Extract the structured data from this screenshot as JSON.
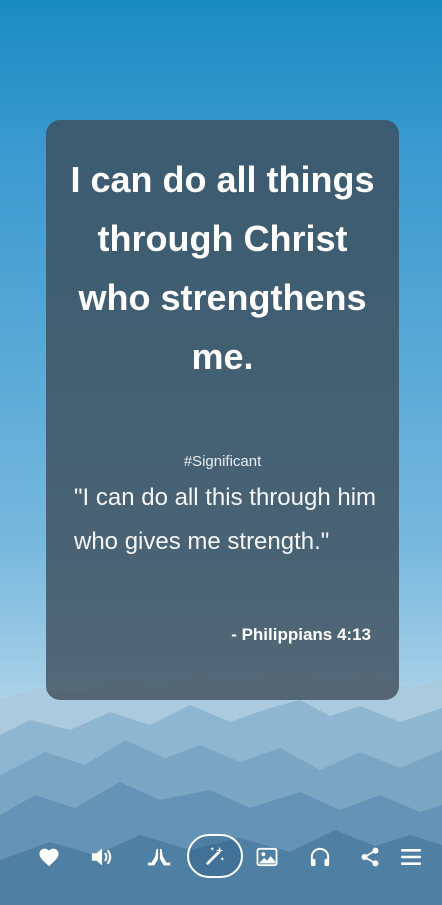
{
  "quote": {
    "headline": "I can do all things through Christ who strengthens me.",
    "hashtag": "#Significant",
    "verse": "\"I can do all this through him who gives me strength.\"",
    "reference": "- Philippians 4:13"
  },
  "toolbar": {
    "items": [
      {
        "icon": "heart-icon",
        "label": "Like"
      },
      {
        "icon": "speaker-icon",
        "label": "Listen"
      },
      {
        "icon": "praying-hands-icon",
        "label": "Pray"
      },
      {
        "icon": "magic-wand-icon",
        "label": "Magic",
        "active": true
      },
      {
        "icon": "image-icon",
        "label": "Backgrounds"
      },
      {
        "icon": "headphones-icon",
        "label": "Audio"
      },
      {
        "icon": "share-icon",
        "label": "Share"
      },
      {
        "icon": "menu-icon",
        "label": "Menu"
      }
    ]
  },
  "colors": {
    "sky_top": "#1a8bc2",
    "sky_bottom": "#b5d6ea",
    "card_bg": "rgba(60,74,86,0.78)",
    "text": "#ffffff"
  }
}
